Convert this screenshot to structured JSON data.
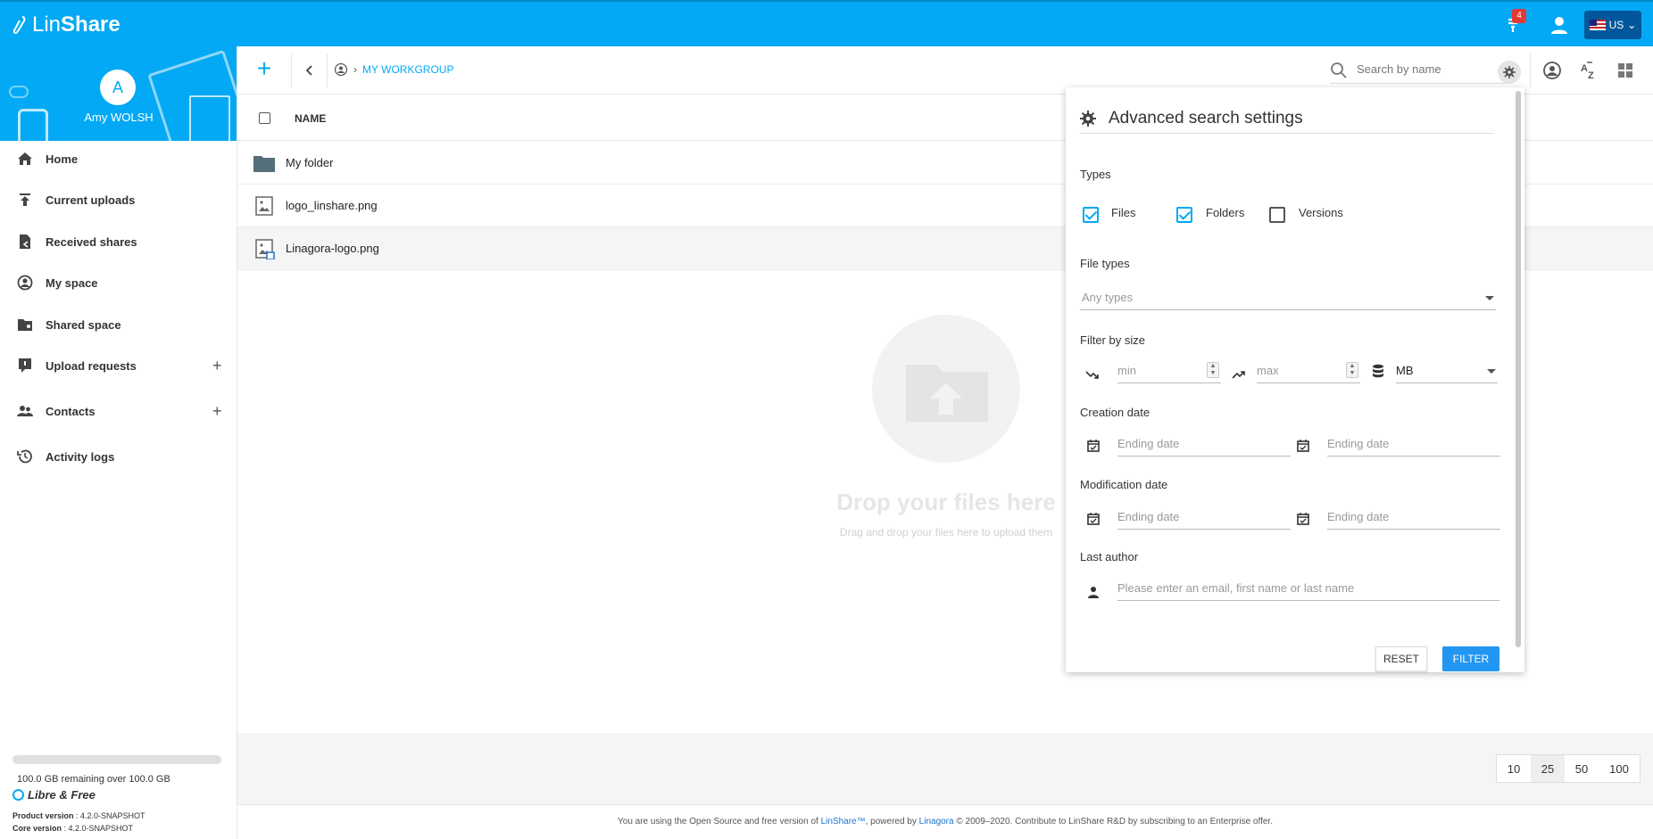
{
  "header": {
    "logo_lin": "Lin",
    "logo_share": "Share",
    "notifications_count": "4",
    "language": "US"
  },
  "sidebar": {
    "avatar_initial": "A",
    "user_name": "Amy WOLSH",
    "items": [
      {
        "label": "Home",
        "icon": "home-icon"
      },
      {
        "label": "Current uploads",
        "icon": "upload-icon"
      },
      {
        "label": "Received shares",
        "icon": "received-shares-icon"
      },
      {
        "label": "My space",
        "icon": "user-circle-icon"
      },
      {
        "label": "Shared space",
        "icon": "shared-space-icon"
      },
      {
        "label": "Upload requests",
        "icon": "upload-request-icon"
      },
      {
        "label": "Contacts",
        "icon": "contacts-icon"
      },
      {
        "label": "Activity logs",
        "icon": "history-icon"
      }
    ],
    "quota_text": "100.0 GB remaining over 100.0 GB",
    "quota_used_fraction": 0.0,
    "libre": "Libre & Free",
    "product_version_label": "Product version",
    "product_version": " : 4.2.0-SNAPSHOT",
    "core_version_label": "Core version",
    "core_version": " : 4.2.0-SNAPSHOT"
  },
  "toolbar": {
    "breadcrumb_current": "MY WORKGROUP",
    "search_placeholder": "Search by name"
  },
  "table": {
    "column_name": "NAME",
    "rows": [
      {
        "name": "My folder",
        "type": "folder"
      },
      {
        "name": "logo_linshare.png",
        "type": "image"
      },
      {
        "name": "Linagora-logo.png",
        "type": "image-shared"
      }
    ]
  },
  "dropzone": {
    "title": "Drop your files here",
    "subtitle": "Drag and drop your files here to upload them"
  },
  "pagination": {
    "options": [
      "10",
      "25",
      "50",
      "100"
    ],
    "selected": "25"
  },
  "footer": {
    "text_before": "You are using the Open Source and free version of ",
    "link1": "LinShare™",
    "text_mid": ", powered by ",
    "link2": "Linagora",
    "text_after": " © 2009–2020. Contribute to LinShare R&D by subscribing to an Enterprise offer."
  },
  "advanced_search": {
    "title": "Advanced search settings",
    "types_label": "Types",
    "types": [
      {
        "label": "Files",
        "checked": true
      },
      {
        "label": "Folders",
        "checked": true
      },
      {
        "label": "Versions",
        "checked": false
      }
    ],
    "file_types_label": "File types",
    "file_types_placeholder": "Any types",
    "size_label": "Filter by size",
    "size_min_placeholder": "min",
    "size_max_placeholder": "max",
    "size_unit": "MB",
    "creation_label": "Creation date",
    "creation_start_placeholder": "Ending date",
    "creation_end_placeholder": "Ending date",
    "modification_label": "Modification date",
    "modification_start_placeholder": "Ending date",
    "modification_end_placeholder": "Ending date",
    "author_label": "Last author",
    "author_placeholder": "Please enter an email, first name or last name",
    "reset_label": "RESET",
    "filter_label": "FILTER"
  }
}
